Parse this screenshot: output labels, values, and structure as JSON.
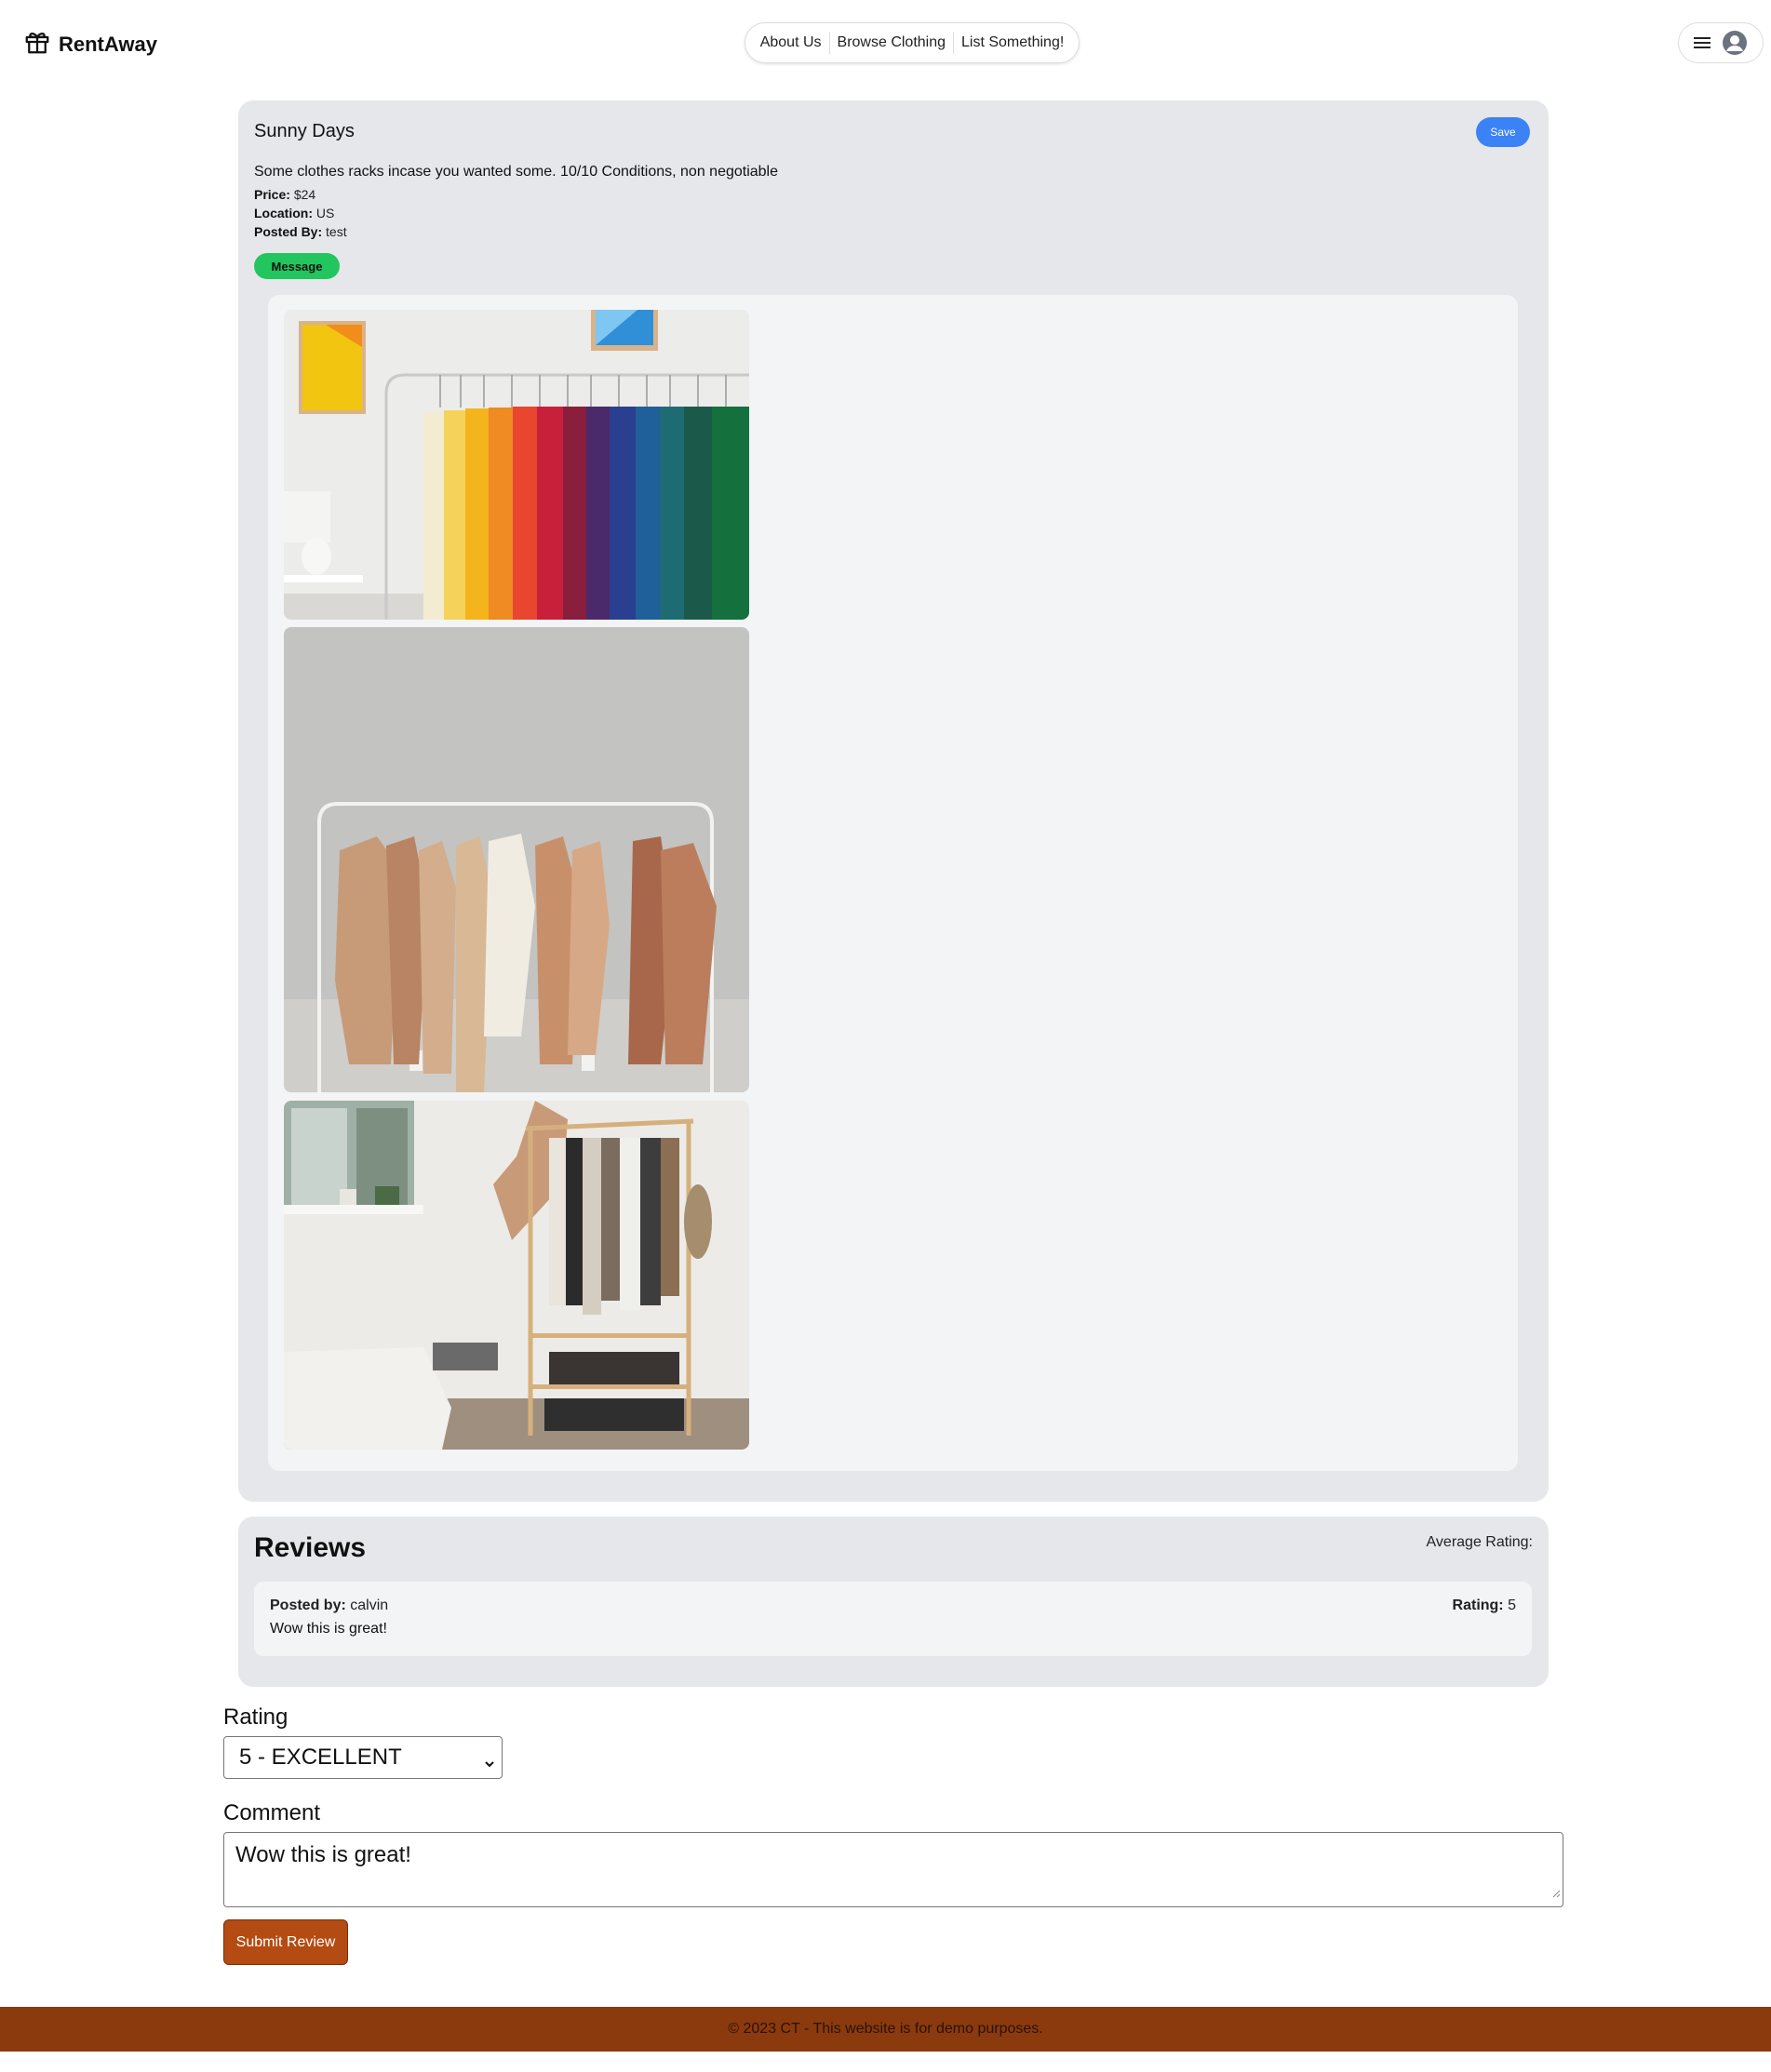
{
  "brand": {
    "name": "RentAway",
    "logo_icon": "gift-icon"
  },
  "nav": {
    "items": [
      "About Us",
      "Browse Clothing",
      "List Something!"
    ]
  },
  "user_menu": {
    "icons": [
      "menu-icon",
      "user-avatar-icon"
    ]
  },
  "listing": {
    "title": "Sunny Days",
    "save_label": "Save",
    "description": "Some clothes racks incase you wanted some. 10/10 Conditions, non negotiable",
    "price_label": "Price:",
    "price_value": "$24",
    "location_label": "Location:",
    "location_value": "US",
    "posted_by_label": "Posted By:",
    "posted_by_value": "test",
    "message_label": "Message",
    "photos": [
      "rainbow-clothes-rack-photo",
      "neutral-clothes-rack-photo",
      "bedroom-clothes-rack-photo"
    ]
  },
  "reviews": {
    "title": "Reviews",
    "average_label": "Average Rating:",
    "items": [
      {
        "posted_by_label": "Posted by:",
        "author": "calvin",
        "rating_label": "Rating:",
        "rating": "5",
        "text": "Wow this is great!"
      }
    ]
  },
  "form": {
    "rating_label": "Rating",
    "rating_selected": "5 - EXCELLENT",
    "comment_label": "Comment",
    "comment_value": "Wow this is great!",
    "submit_label": "Submit Review"
  },
  "footer": {
    "text": "© 2023 CT - This website is for demo purposes."
  },
  "colors": {
    "save": "#3b82f6",
    "message": "#22c55e",
    "submit": "#b44b12",
    "footer": "#8b3a0e",
    "card": "#e5e7eb",
    "inner": "#f3f4f6"
  }
}
